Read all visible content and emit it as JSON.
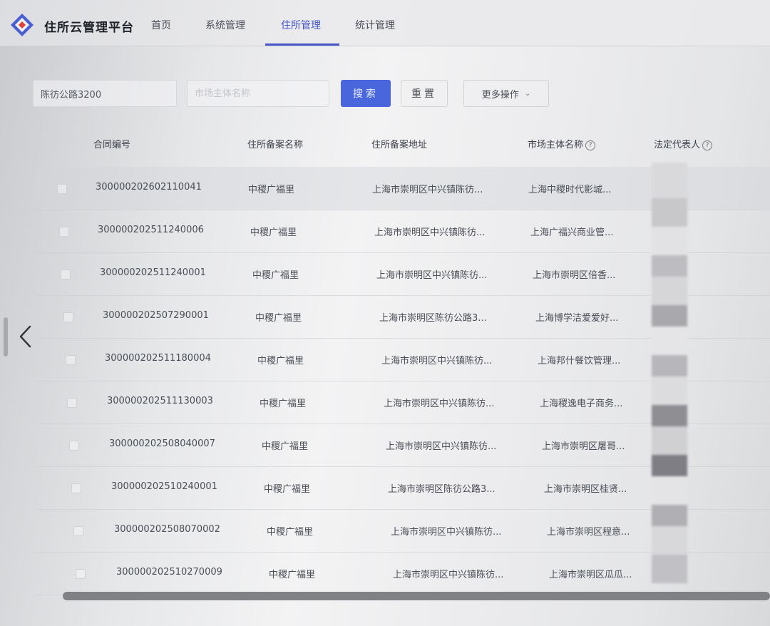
{
  "app": {
    "title": "住所云管理平台"
  },
  "nav": {
    "tabs": [
      {
        "label": "首页"
      },
      {
        "label": "系统管理"
      },
      {
        "label": "住所管理",
        "active": true
      },
      {
        "label": "统计管理"
      }
    ]
  },
  "search": {
    "address_value": "陈彷公路3200",
    "entity_placeholder": "市场主体名称",
    "search_button": "搜索",
    "reset_button": "重置",
    "more_button": "更多操作"
  },
  "table": {
    "headers": {
      "contract_no": "合同编号",
      "filing_name": "住所备案名称",
      "filing_address": "住所备案地址",
      "entity_name": "市场主体名称",
      "legal_rep": "法定代表人"
    },
    "rows": [
      {
        "contract_no": "300000202602110041",
        "filing_name": "中稷广福里",
        "filing_address": "上海市崇明区中兴镇陈彷...",
        "entity_name": "上海中稷时代影城..."
      },
      {
        "contract_no": "300000202511240006",
        "filing_name": "中稷广福里",
        "filing_address": "上海市崇明区中兴镇陈彷...",
        "entity_name": "上海广福兴商业管..."
      },
      {
        "contract_no": "300000202511240001",
        "filing_name": "中稷广福里",
        "filing_address": "上海市崇明区中兴镇陈彷...",
        "entity_name": "上海市崇明区倍香..."
      },
      {
        "contract_no": "300000202507290001",
        "filing_name": "中稷广福里",
        "filing_address": "上海市崇明区陈彷公路3...",
        "entity_name": "上海博学洁爱爱好..."
      },
      {
        "contract_no": "300000202511180004",
        "filing_name": "中稷广福里",
        "filing_address": "上海市崇明区中兴镇陈彷...",
        "entity_name": "上海邦什餐饮管理..."
      },
      {
        "contract_no": "300000202511130003",
        "filing_name": "中稷广福里",
        "filing_address": "上海市崇明区中兴镇陈彷...",
        "entity_name": "上海稷逸电子商务..."
      },
      {
        "contract_no": "300000202508040007",
        "filing_name": "中稷广福里",
        "filing_address": "上海市崇明区中兴镇陈彷...",
        "entity_name": "上海市崇明区屠哥..."
      },
      {
        "contract_no": "300000202510240001",
        "filing_name": "中稷广福里",
        "filing_address": "上海市崇明区陈彷公路3...",
        "entity_name": "上海市崇明区桂贤..."
      },
      {
        "contract_no": "300000202508070002",
        "filing_name": "中稷广福里",
        "filing_address": "上海市崇明区中兴镇陈彷...",
        "entity_name": "上海市崇明区程意..."
      },
      {
        "contract_no": "300000202510270009",
        "filing_name": "中稷广福里",
        "filing_address": "上海市崇明区中兴镇陈彷...",
        "entity_name": "上海市崇明区瓜瓜..."
      }
    ]
  },
  "colors": {
    "accent": "#4656c8",
    "primary_button": "#4a66dc"
  }
}
